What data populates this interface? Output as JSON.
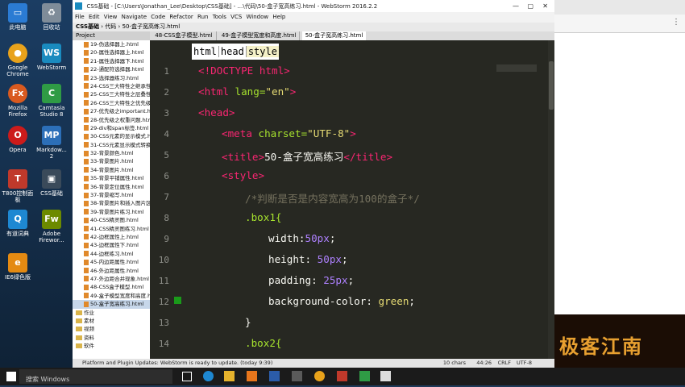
{
  "window": {
    "title": "CSS基础 - [C:\\Users\\Jonathan_Lee\\Desktop\\CSS基础] - ...\\代码\\50-盒子宽高练习.html - WebStorm 2016.2.2",
    "menu": [
      "File",
      "Edit",
      "View",
      "Navigate",
      "Code",
      "Refactor",
      "Run",
      "Tools",
      "VCS",
      "Window",
      "Help"
    ],
    "breadcrumb": [
      "CSS基础",
      "代码",
      "50-盒子宽高练习.html"
    ],
    "project_label": "Project",
    "tabs": [
      "48-CSS盒子模型.html",
      "49-盒子模型宽度和高度.html",
      "50-盒子宽高练习.html"
    ],
    "bread_tags": [
      "html",
      "head",
      "style"
    ]
  },
  "desktop_icons": [
    {
      "label": "此电脑",
      "color": "#2b7bd3",
      "glyph": "PC"
    },
    {
      "label": "回收站",
      "color": "#7f8c99",
      "glyph": "♻"
    },
    {
      "label": "Google Chrome",
      "color": "#e8a21b",
      "glyph": "●"
    },
    {
      "label": "WebStorm",
      "color": "#1a8bbf",
      "glyph": "WS"
    },
    {
      "label": "Mozilla Firefox",
      "color": "#d95a1f",
      "glyph": "Fx"
    },
    {
      "label": "Camtasia Studio 8",
      "color": "#2f9b45",
      "glyph": "C"
    },
    {
      "label": "Opera",
      "color": "#cc1b1b",
      "glyph": "O"
    },
    {
      "label": "Markdow... 2",
      "color": "#2c6fb8",
      "glyph": "MP"
    },
    {
      "label": "T800控制面板",
      "color": "#c0392b",
      "glyph": "T"
    },
    {
      "label": "CSS基础",
      "color": "#3a4a5a",
      "glyph": "▣"
    },
    {
      "label": "有道词典",
      "color": "#1e88d2",
      "glyph": "Q"
    },
    {
      "label": "Adobe Firewor...",
      "color": "#6c8a00",
      "glyph": "Fw"
    },
    {
      "label": "IE6绿色版",
      "color": "#e48a12",
      "glyph": "e"
    }
  ],
  "project_files": [
    "19-伪选择器上.html",
    "20-属性选择器上.html",
    "21-属性选择器下.html",
    "22-通配符选择器.html",
    "23-选择器练习.html",
    "24-CSS三大特性之继承性",
    "25-CSS三大特性之层叠性",
    "26-CSS三大特性之优先级",
    "27-优先级之important.h",
    "28-优先级之权重问题.htm",
    "29-div和span标签.html",
    "30-CSS元素的显示模式.h",
    "31-CSS元素显示模式转换",
    "32-背景颜色.html",
    "33-背景图片.html",
    "34-背景图片.html",
    "35-背景平铺属性.html",
    "36-背景定位属性.html",
    "37-背景缩写.html",
    "38-背景图片和插入图片区",
    "39-背景图片练习.html",
    "40-CSS精灵图.html",
    "41-CSS精灵图练习.html",
    "42-边框属性上.html",
    "43-边框属性下.html",
    "44-边框练习.html",
    "45-内边距属性.html",
    "46-外边距属性.html",
    "47-外边距合并现象.html",
    "48-CSS盒子模型.html",
    "49-盒子模型宽度和高度.h",
    "50-盒子宽高练习.html"
  ],
  "project_folders": [
    "作业",
    "素材",
    "视频",
    "资料",
    "软件"
  ],
  "code_lines": [
    {
      "n": "1"
    },
    {
      "n": "2"
    },
    {
      "n": "3"
    },
    {
      "n": "4"
    },
    {
      "n": "5"
    },
    {
      "n": "6"
    },
    {
      "n": "7"
    },
    {
      "n": "8"
    },
    {
      "n": "9"
    },
    {
      "n": "10"
    },
    {
      "n": "11"
    },
    {
      "n": "12"
    },
    {
      "n": "13"
    },
    {
      "n": "14"
    }
  ],
  "code": {
    "l1a": "<!DOCTYPE html>",
    "l2a": "<html ",
    "l2b": "lang=",
    "l2c": "\"en\"",
    "l2d": ">",
    "l3a": "<head>",
    "l4a": "<meta ",
    "l4b": "charset=",
    "l4c": "\"UTF-8\"",
    "l4d": ">",
    "l5a": "<title>",
    "l5b": "50-盒子宽高练习",
    "l5c": "</title>",
    "l6a": "<style>",
    "l7a": "/*判断是否是内容宽高为100的盒子*/",
    "l8a": ".box1{",
    "l9a": "width:",
    "l9b": "50px",
    ";": ";",
    "l10a": "height: ",
    "l10b": "50px",
    "l11a": "padding: ",
    "l11b": "25px",
    "l12a": "background-color: ",
    "l12b": "green",
    "l13a": "}",
    "l14a": ".box2{"
  },
  "status": {
    "message": "Platform and Plugin Updates: WebStorm is ready to update. (today 9:39)",
    "chars": "10 chars",
    "pos": "44:26",
    "crlf": "CRLF",
    "enc": "UTF-8"
  },
  "taskbar": {
    "search": "搜索 Windows"
  },
  "watermark": "极客江南"
}
